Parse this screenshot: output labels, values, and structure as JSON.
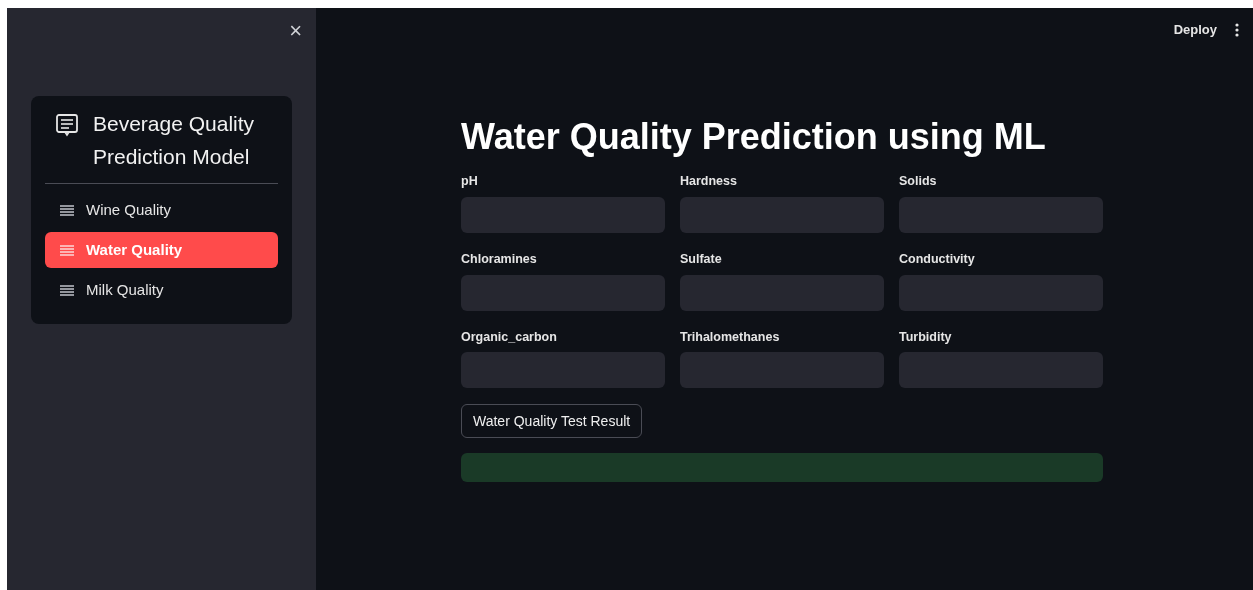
{
  "sidebar": {
    "close_button": "×",
    "menu": {
      "title": "Beverage Quality Prediction Model",
      "items": [
        {
          "label": "Wine Quality",
          "selected": false
        },
        {
          "label": "Water Quality",
          "selected": true
        },
        {
          "label": "Milk Quality",
          "selected": false
        }
      ]
    }
  },
  "header": {
    "deploy": "Deploy"
  },
  "main": {
    "title": "Water Quality Prediction using ML",
    "fields": [
      {
        "label": "pH"
      },
      {
        "label": "Hardness"
      },
      {
        "label": "Solids"
      },
      {
        "label": "Chloramines"
      },
      {
        "label": "Sulfate"
      },
      {
        "label": "Conductivity"
      },
      {
        "label": "Organic_carbon"
      },
      {
        "label": "Trihalomethanes"
      },
      {
        "label": "Turbidity"
      }
    ],
    "button": "Water Quality Test Result"
  }
}
